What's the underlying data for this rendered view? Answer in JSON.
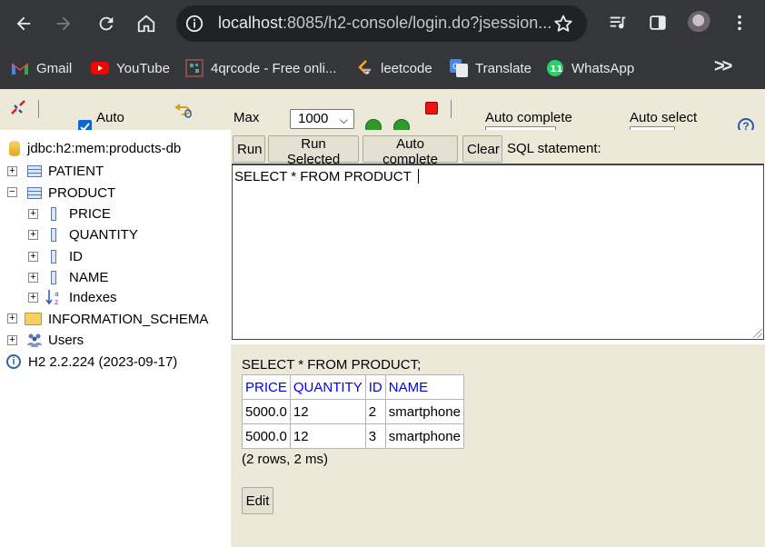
{
  "browser": {
    "url_host": "localhost",
    "url_rest": ":8085/h2-console/login.do?jsession...",
    "bookmarks": [
      "Gmail",
      "YouTube",
      "4qrcode - Free onli...",
      "leetcode",
      "Translate",
      "WhatsApp"
    ],
    "more_label": ">>",
    "whatsapp_badge": "11"
  },
  "toolbar": {
    "auto_commit_label": "Auto",
    "max_label": "Max",
    "max_rows_value": "1000",
    "auto_complete_label": "Auto complete",
    "auto_select_label": "Auto select",
    "help_label": "?"
  },
  "tree": {
    "connection": "jdbc:h2:mem:products-db",
    "tables": [
      {
        "name": "PATIENT",
        "expanded": false
      },
      {
        "name": "PRODUCT",
        "expanded": true,
        "columns": [
          "PRICE",
          "QUANTITY",
          "ID",
          "NAME"
        ],
        "indexes_label": "Indexes"
      }
    ],
    "information_schema": "INFORMATION_SCHEMA",
    "users": "Users",
    "version": "H2 2.2.224 (2023-09-17)"
  },
  "query_bar": {
    "run": "Run",
    "run_selected": "Run Selected",
    "auto_complete": "Auto complete",
    "clear": "Clear",
    "sql_statement_label": "SQL statement:"
  },
  "editor": {
    "sql": "SELECT * FROM PRODUCT "
  },
  "result": {
    "statement": "SELECT * FROM PRODUCT;",
    "columns": [
      "PRICE",
      "QUANTITY",
      "ID",
      "NAME"
    ],
    "rows": [
      [
        "5000.0",
        "12",
        "2",
        "smartphone"
      ],
      [
        "5000.0",
        "12",
        "3",
        "smartphone"
      ]
    ],
    "summary": "(2 rows, 2 ms)",
    "edit_label": "Edit"
  },
  "colors": {
    "chrome_bg": "#35363a",
    "omnibox_bg": "#202124",
    "h2_panel_bg": "#ece9d8",
    "header_link": "#0000ee"
  }
}
